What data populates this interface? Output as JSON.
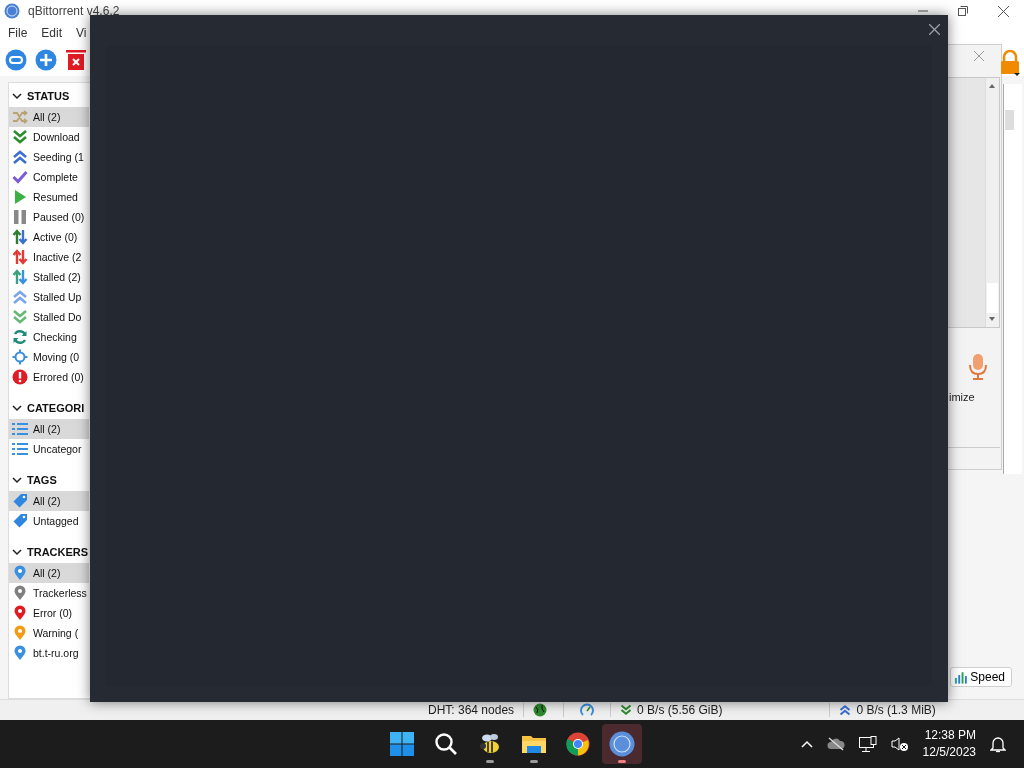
{
  "window": {
    "title": "qBittorrent v4.6.2"
  },
  "menu": [
    {
      "label": "File"
    },
    {
      "label": "Edit"
    },
    {
      "label": "Vi"
    }
  ],
  "sidebar": {
    "sections": [
      {
        "title": "STATUS",
        "expanded": true,
        "items": [
          {
            "label": "All (2)",
            "kind": "all",
            "selected": true
          },
          {
            "label": "Download",
            "kind": "downloading",
            "selected": false
          },
          {
            "label": "Seeding (1",
            "kind": "seeding",
            "selected": false
          },
          {
            "label": "Complete",
            "kind": "completed",
            "selected": false
          },
          {
            "label": "Resumed",
            "kind": "resumed",
            "selected": false
          },
          {
            "label": "Paused (0)",
            "kind": "paused",
            "selected": false
          },
          {
            "label": "Active (0)",
            "kind": "active",
            "selected": false
          },
          {
            "label": "Inactive (2",
            "kind": "inactive",
            "selected": false
          },
          {
            "label": "Stalled (2)",
            "kind": "stalled",
            "selected": false
          },
          {
            "label": "Stalled Up",
            "kind": "stalled_up",
            "selected": false
          },
          {
            "label": "Stalled Do",
            "kind": "stalled_down",
            "selected": false
          },
          {
            "label": "Checking",
            "kind": "checking",
            "selected": false
          },
          {
            "label": "Moving (0",
            "kind": "moving",
            "selected": false
          },
          {
            "label": "Errored (0)",
            "kind": "errored",
            "selected": false
          }
        ]
      },
      {
        "title": "CATEGORI",
        "expanded": true,
        "items": [
          {
            "label": "All (2)",
            "kind": "category",
            "selected": true
          },
          {
            "label": "Uncategor",
            "kind": "category",
            "selected": false
          }
        ]
      },
      {
        "title": "TAGS",
        "expanded": true,
        "items": [
          {
            "label": "All (2)",
            "kind": "tag",
            "selected": true
          },
          {
            "label": "Untagged",
            "kind": "tag",
            "selected": false
          }
        ]
      },
      {
        "title": "TRACKERS",
        "expanded": true,
        "items": [
          {
            "label": "All (2)",
            "kind": "tracker_all",
            "selected": true
          },
          {
            "label": "Trackerless",
            "kind": "tracker_none",
            "selected": false
          },
          {
            "label": "Error (0)",
            "kind": "tracker_error",
            "selected": false
          },
          {
            "label": "Warning (",
            "kind": "tracker_warning",
            "selected": false
          },
          {
            "label": "bt.t-ru.org",
            "kind": "tracker_site",
            "selected": false
          }
        ]
      }
    ]
  },
  "side_window": {
    "button_text": "imize"
  },
  "speed_button": {
    "label": "Speed"
  },
  "status_bar": {
    "dht": "DHT: 364 nodes",
    "download": "0 B/s (5.56 GiB)",
    "upload": "0 B/s (1.3 MiB)"
  },
  "taskbar": {
    "apps": [
      {
        "kind": "start",
        "running": false,
        "active": false
      },
      {
        "kind": "search",
        "running": false,
        "active": false
      },
      {
        "kind": "bee",
        "running": true,
        "active": false
      },
      {
        "kind": "files",
        "running": true,
        "active": false
      },
      {
        "kind": "browser",
        "running": false,
        "active": false
      },
      {
        "kind": "qbittorrent",
        "running": true,
        "active": true
      }
    ],
    "clock": {
      "time": "12:38 PM",
      "date": "12/5/2023"
    }
  }
}
